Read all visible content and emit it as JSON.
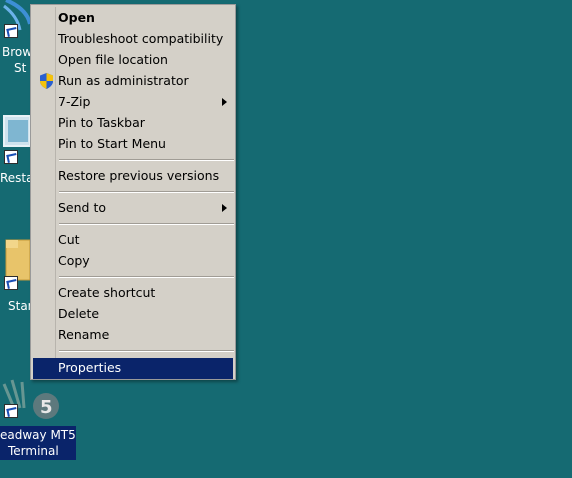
{
  "desktop": {
    "background": "#156a72",
    "icons": [
      {
        "label_line1": "Brow",
        "label_line2": "St"
      },
      {
        "label_line1": "Resta"
      },
      {
        "label_line1": "Star"
      },
      {
        "label_line1": "eadway MT5",
        "label_line2": "Terminal",
        "badge": "5"
      }
    ]
  },
  "context_menu": {
    "items": [
      {
        "label": "Open",
        "bold": true
      },
      {
        "label": "Troubleshoot compatibility"
      },
      {
        "label": "Open file location"
      },
      {
        "label": "Run as administrator",
        "icon": "uac-shield-icon"
      },
      {
        "label": "7-Zip",
        "submenu": true
      },
      {
        "label": "Pin to Taskbar"
      },
      {
        "label": "Pin to Start Menu"
      },
      {
        "label": "Restore previous versions"
      },
      {
        "label": "Send to",
        "submenu": true
      },
      {
        "label": "Cut"
      },
      {
        "label": "Copy"
      },
      {
        "label": "Create shortcut"
      },
      {
        "label": "Delete"
      },
      {
        "label": "Rename"
      },
      {
        "label": "Properties",
        "selected": true
      }
    ],
    "selection_color": "#0a246a"
  }
}
